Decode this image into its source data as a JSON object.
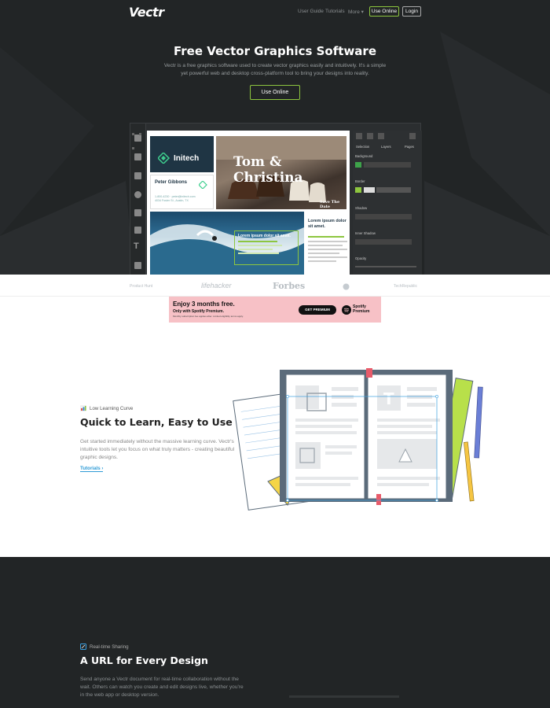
{
  "nav": {
    "logo": "Vectr",
    "links": [
      "User Guide",
      "Tutorials",
      "More ▾"
    ],
    "use_online": "Use Online",
    "login": "Login"
  },
  "hero": {
    "title": "Free Vector Graphics Software",
    "subtitle": "Vectr is a free graphics software used to create vector graphics easily and intuitively. It's a simple yet powerful web and desktop cross-platform tool to bring your designs into reality.",
    "cta": "Use Online"
  },
  "mockup": {
    "company": "Initech",
    "person_name": "Peter Gibbons",
    "person_meta": [
      "1-800-4230  ·  peter@initech.com",
      "4034 Foster St., Austin, TX"
    ],
    "couple": "Tom & Christina",
    "save_date": "Save The Date",
    "wave_title": "Lorem ipsum dolor sit amet.",
    "right_title": "Lorem ipsum dolor sit amet.",
    "panel_tabs": [
      "Selection",
      "Layers",
      "Pages"
    ],
    "panel_labels": [
      "Background",
      "Border",
      "Shadow",
      "Inner Shadow",
      "Opacity"
    ]
  },
  "press": [
    "Product Hunt",
    "lifehacker",
    "Forbes",
    "",
    "TechRepublic"
  ],
  "ad": {
    "title": "Enjoy 3 months free.",
    "subtitle": "Only with Spotify Premium.",
    "fine_print": "Monthly subscription fee applies after. Limited eligibility terms apply.",
    "button": "GET PREMIUM",
    "brand": "Spotify Premium"
  },
  "feature1": {
    "tag": "Low Learning Curve",
    "title": "Quick to Learn, Easy to Use",
    "body": "Get started immediately without the massive learning curve. Vectr's intuitive tools let you focus on what truly matters - creating beautiful graphic designs.",
    "link": "Tutorials ›"
  },
  "feature2": {
    "tag": "Real-time Sharing",
    "title": "A URL for Every Design",
    "body": "Send anyone a Vectr document for real-time collaboration without the wait. Others can watch you create and edit designs live, whether you're in the web app or desktop version."
  },
  "colors": {
    "dark_bg": "#222526",
    "accent_green": "#8dc63f",
    "link_blue": "#2e9bd6",
    "ad_pink": "#f7c1c6"
  }
}
